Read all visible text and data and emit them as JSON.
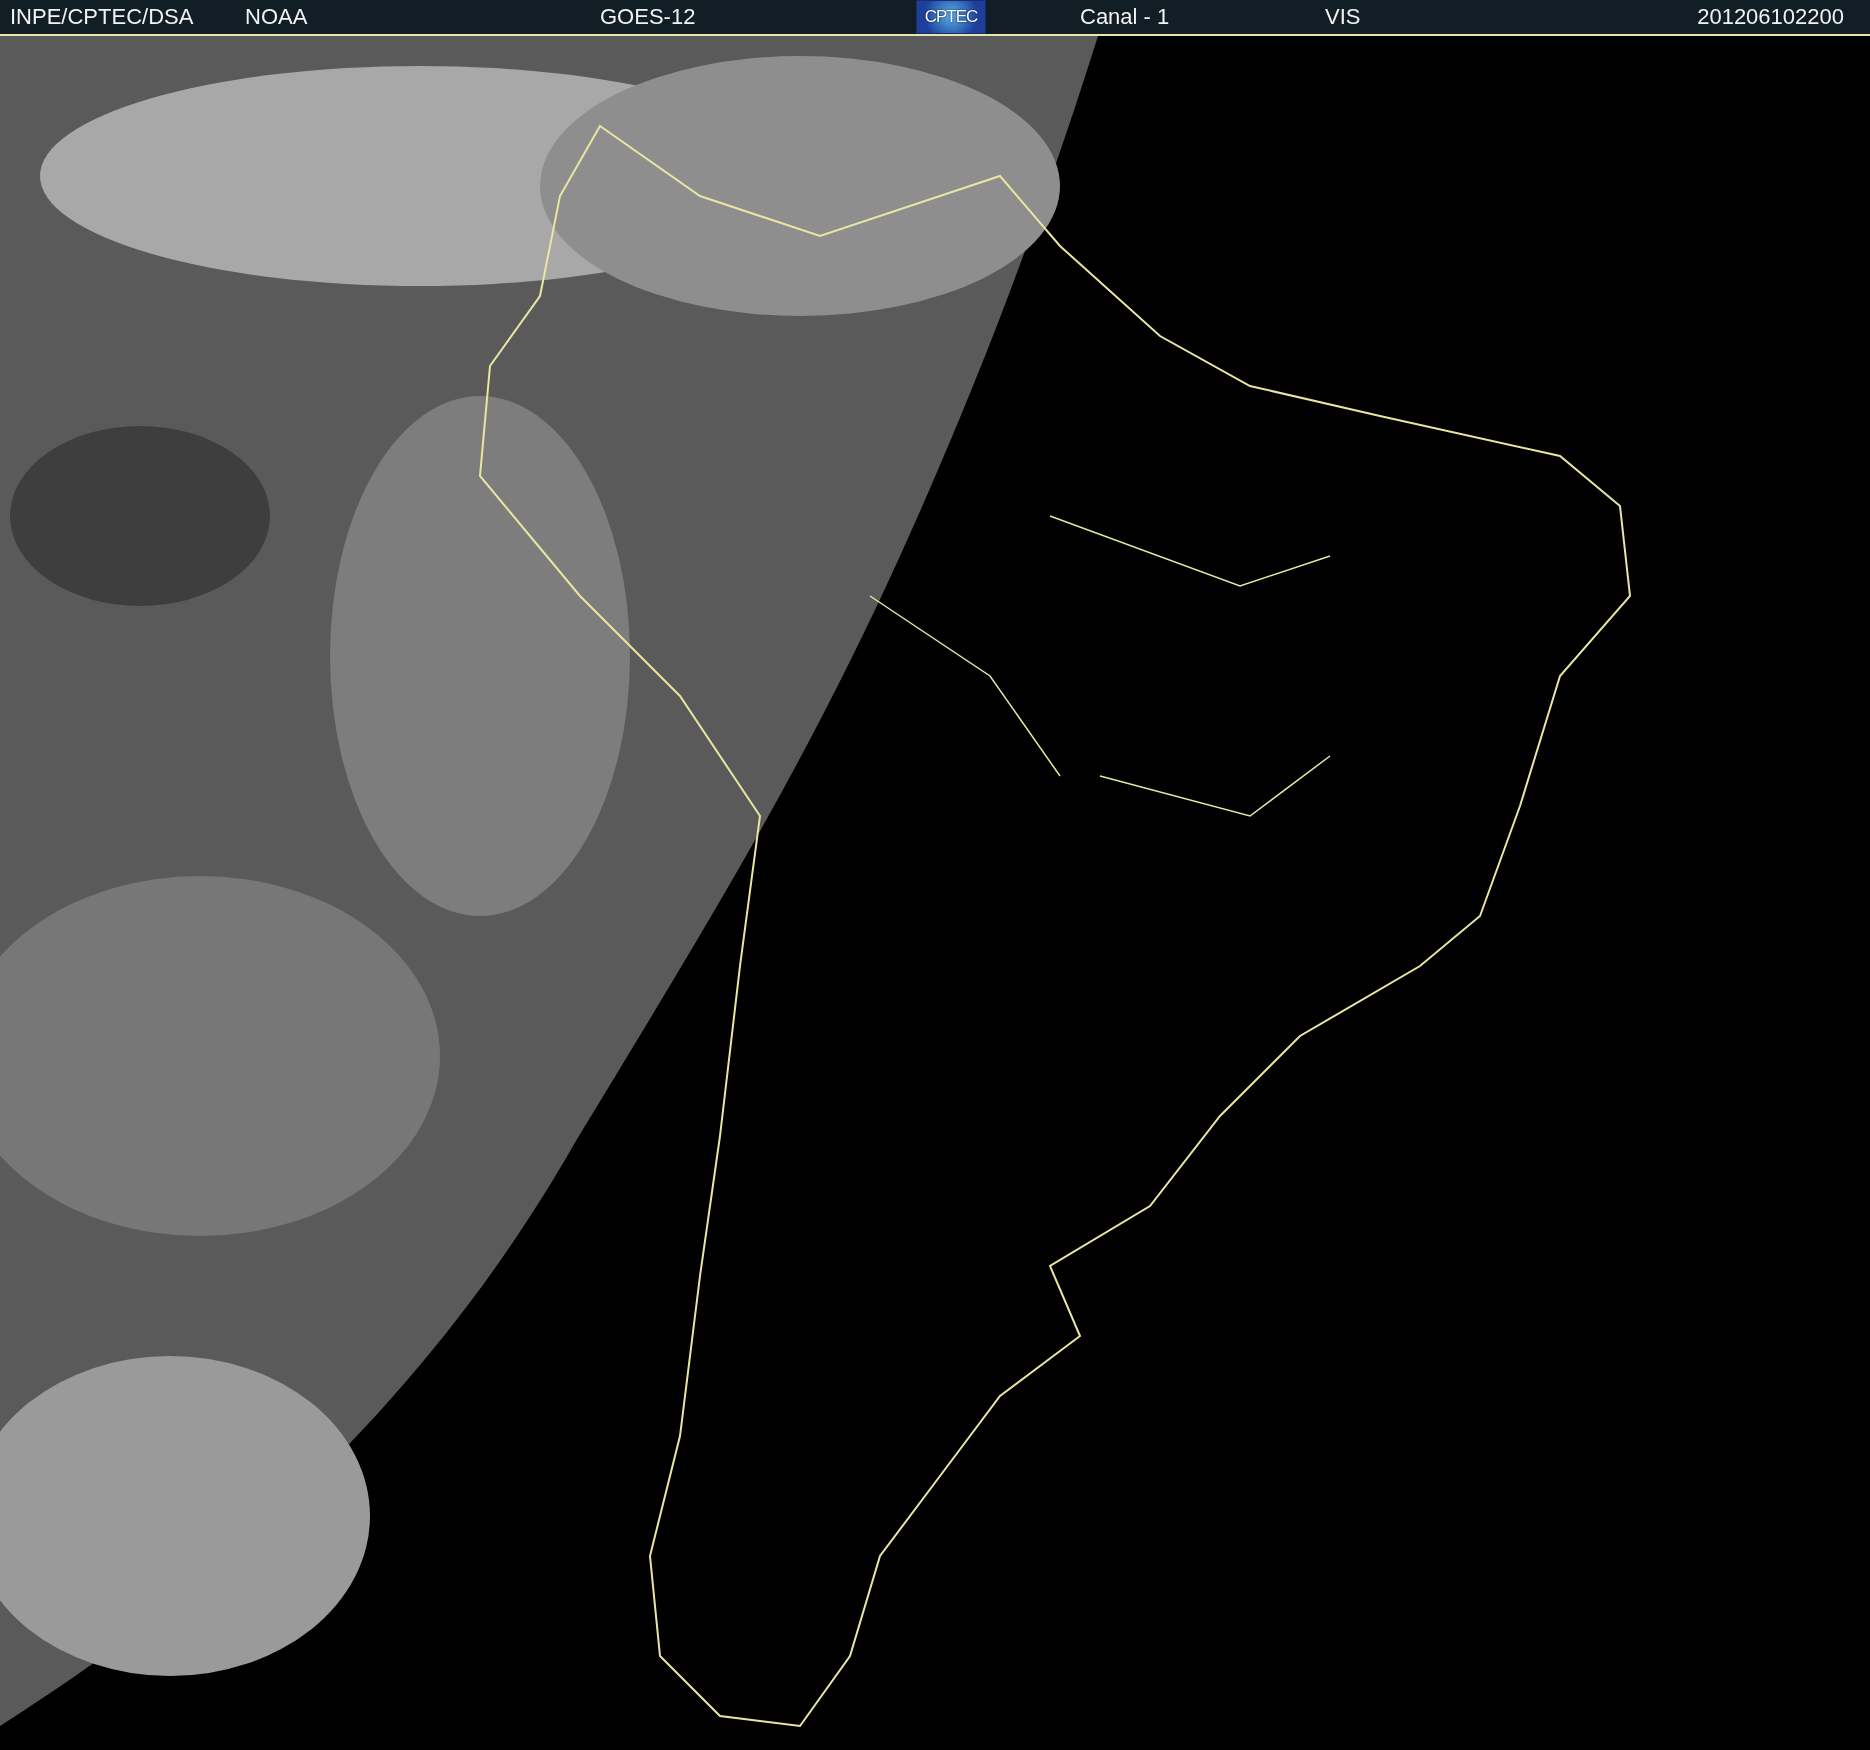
{
  "header": {
    "items": [
      {
        "kind": "text",
        "text": "INPE/CPTEC/DSA"
      },
      {
        "kind": "text",
        "text": "NOAA"
      },
      {
        "kind": "text",
        "text": "GOES-12"
      },
      {
        "kind": "logo",
        "text": "CPTEC"
      },
      {
        "kind": "text",
        "text": "Canal - 1"
      },
      {
        "kind": "text",
        "text": "VIS"
      },
      {
        "kind": "text",
        "text": "201206102200"
      }
    ]
  }
}
